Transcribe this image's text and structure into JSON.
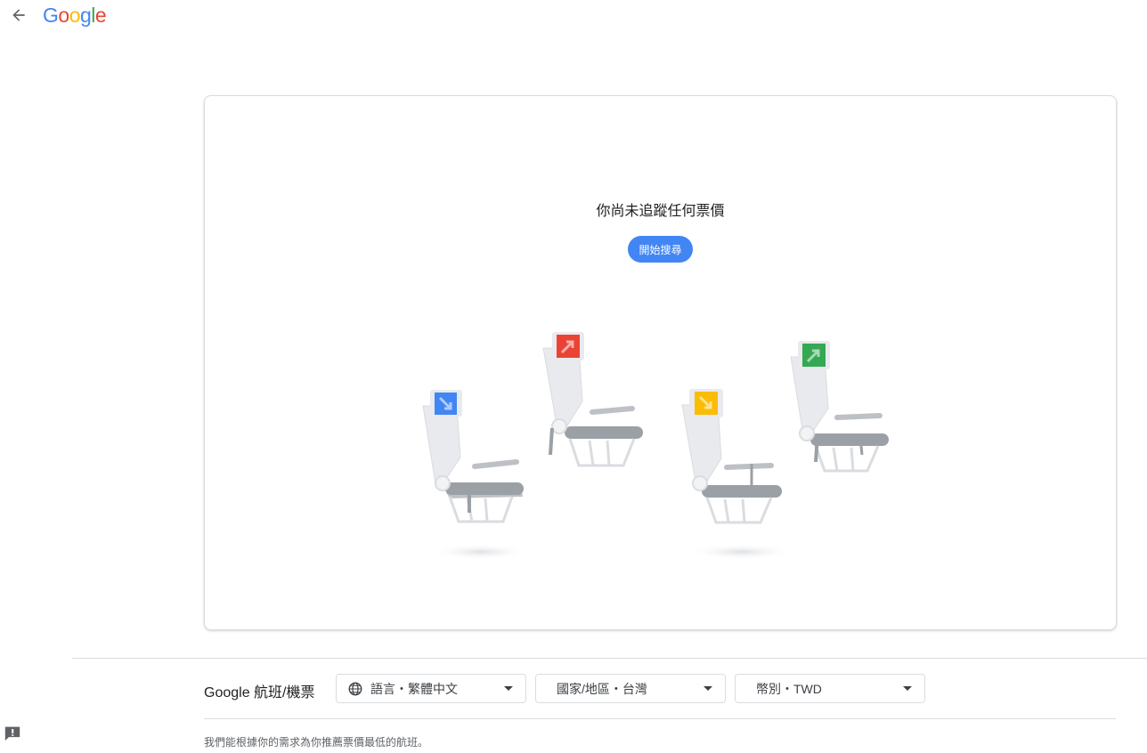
{
  "header": {
    "logo_letters": [
      {
        "ch": "G",
        "color": "#4285f4"
      },
      {
        "ch": "o",
        "color": "#ea4335"
      },
      {
        "ch": "o",
        "color": "#fbbc05"
      },
      {
        "ch": "g",
        "color": "#4285f4"
      },
      {
        "ch": "l",
        "color": "#34a853"
      },
      {
        "ch": "e",
        "color": "#ea4335"
      }
    ],
    "back_icon": "arrow-back-icon"
  },
  "main": {
    "empty_title": "你尚未追蹤任何票價",
    "start_search_label": "開始搜尋",
    "illustration_icon": "airplane-seats-illustration",
    "seat_colors": [
      "#4285f4",
      "#ea4335",
      "#fbbc05",
      "#34a853"
    ]
  },
  "footer": {
    "brand": "Google 航班/機票",
    "language_select": "語言・繁體中文",
    "region_select": "國家/地區・台灣",
    "currency_select": "幣別・TWD",
    "note": "我們能根據你的需求為你推薦票價最低的航班。",
    "globe_icon": "globe-icon",
    "feedback_icon": "feedback-icon"
  },
  "colors": {
    "accent": "#4285f4",
    "border": "#dadce0",
    "text": "#202124",
    "muted": "#5f6368"
  }
}
